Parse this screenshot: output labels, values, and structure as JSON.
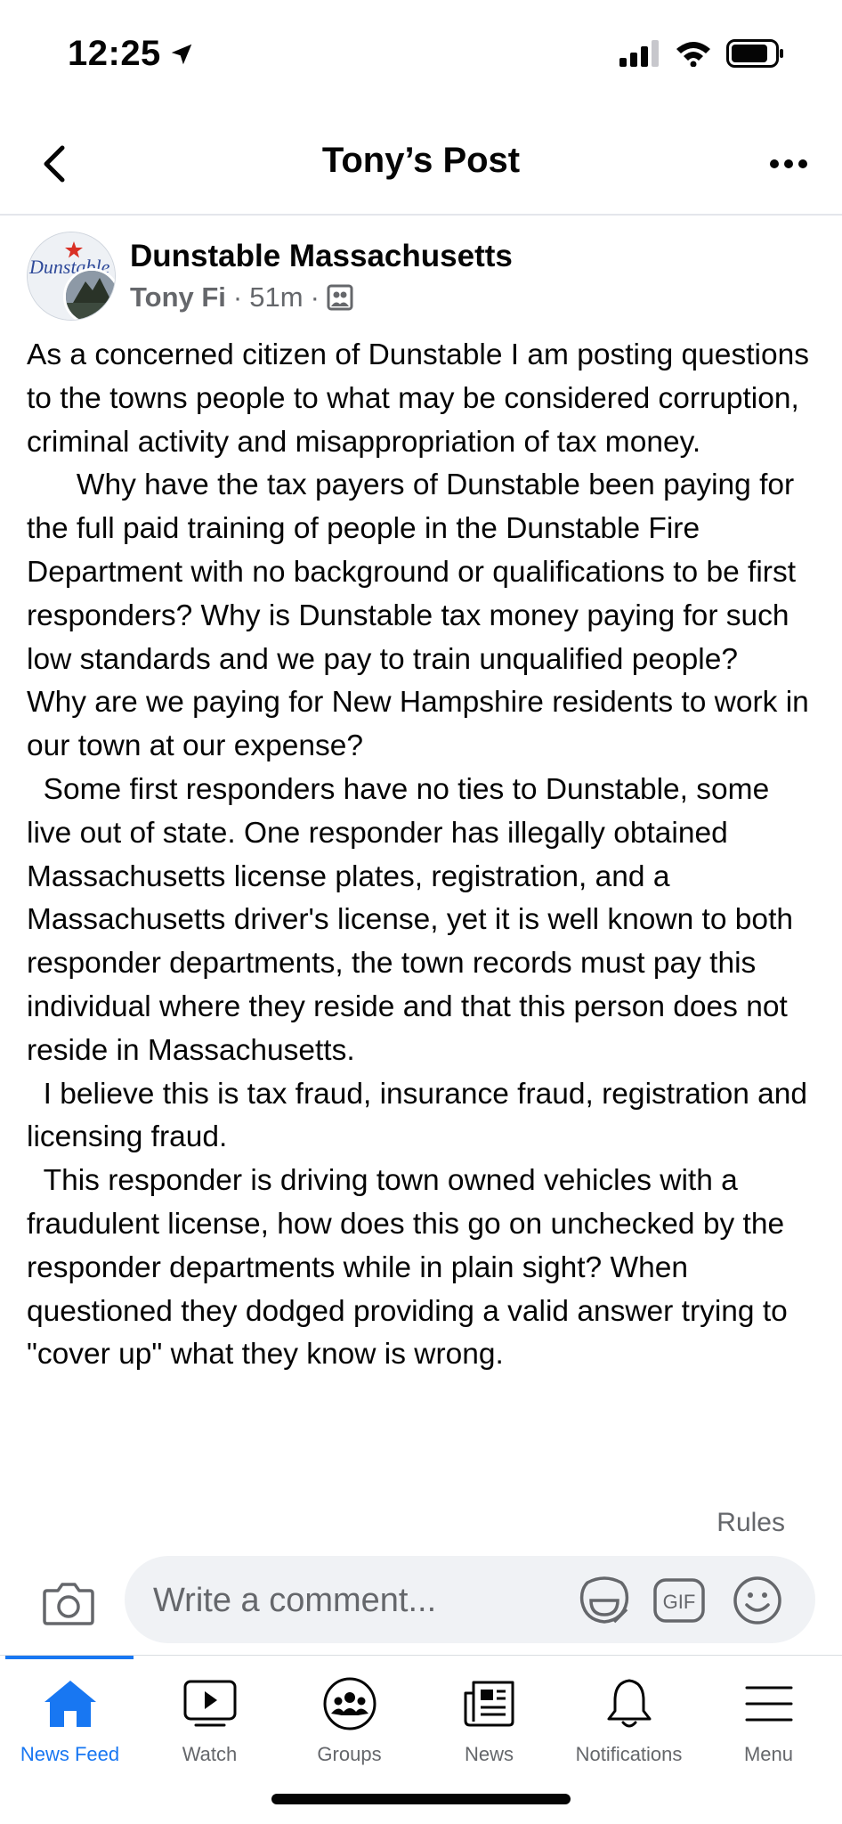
{
  "status_bar": {
    "time": "12:25"
  },
  "header": {
    "title": "Tony’s Post"
  },
  "post": {
    "page_name": "Dunstable Massachusetts",
    "author": "Tony Fi",
    "time_ago": "51m",
    "separator": "·",
    "avatar_text": "Dunstable",
    "paragraphs": [
      "As a concerned citizen of Dunstable I am posting questions to the towns people to what may be considered corruption, criminal activity and misappropriation of tax money.",
      "      Why have the tax payers of Dunstable been paying for the full paid training of people in the Dunstable Fire Department with no background or qualifications to be first responders? Why is Dunstable tax money paying for such low standards and we pay to train unqualified people?",
      "Why are we paying for New Hampshire residents to work in our town at our expense?",
      "  Some first responders have no ties to Dunstable, some live out of state. One responder has illegally obtained Massachusetts license plates, registration, and a Massachusetts driver's license, yet it is well known to both responder departments, the town records must pay this individual where they reside and that this person does not reside in Massachusetts.",
      "  I believe this is tax fraud, insurance fraud, registration and licensing fraud.",
      "  This responder is driving town owned vehicles with a fraudulent license, how does this go on unchecked by the responder departments while in plain sight? When questioned they dodged providing a valid answer trying to \"cover up\" what they know is wrong."
    ]
  },
  "comment": {
    "rules_label": "Rules",
    "placeholder": "Write a comment..."
  },
  "tabs": [
    {
      "label": "News Feed",
      "icon": "home-icon",
      "active": true
    },
    {
      "label": "Watch",
      "icon": "watch-icon",
      "active": false
    },
    {
      "label": "Groups",
      "icon": "groups-icon",
      "active": false
    },
    {
      "label": "News",
      "icon": "news-icon",
      "active": false
    },
    {
      "label": "Notifications",
      "icon": "bell-icon",
      "active": false
    },
    {
      "label": "Menu",
      "icon": "menu-icon",
      "active": false
    }
  ],
  "colors": {
    "accent": "#1877f2",
    "secondary_text": "#65676b",
    "input_bg": "#f0f2f5"
  }
}
